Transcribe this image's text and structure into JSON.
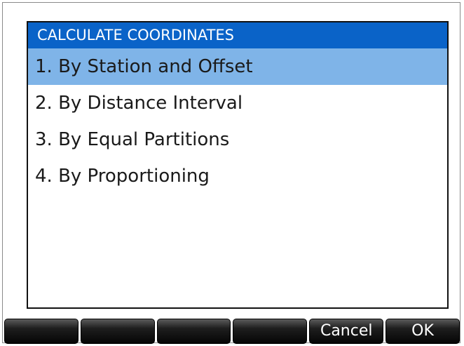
{
  "dialog": {
    "title": "CALCULATE COORDINATES",
    "items": [
      {
        "label": "1. By Station and Offset",
        "selected": true
      },
      {
        "label": "2. By Distance Interval",
        "selected": false
      },
      {
        "label": "3. By Equal Partitions",
        "selected": false
      },
      {
        "label": "4. By Proportioning",
        "selected": false
      }
    ]
  },
  "softkeys": {
    "labels": [
      "",
      "",
      "",
      "",
      "Cancel",
      "OK"
    ]
  },
  "colors": {
    "title_bar": "#0a63c8",
    "selection": "#7fb4e8",
    "softkey": "#1e1e1e"
  }
}
